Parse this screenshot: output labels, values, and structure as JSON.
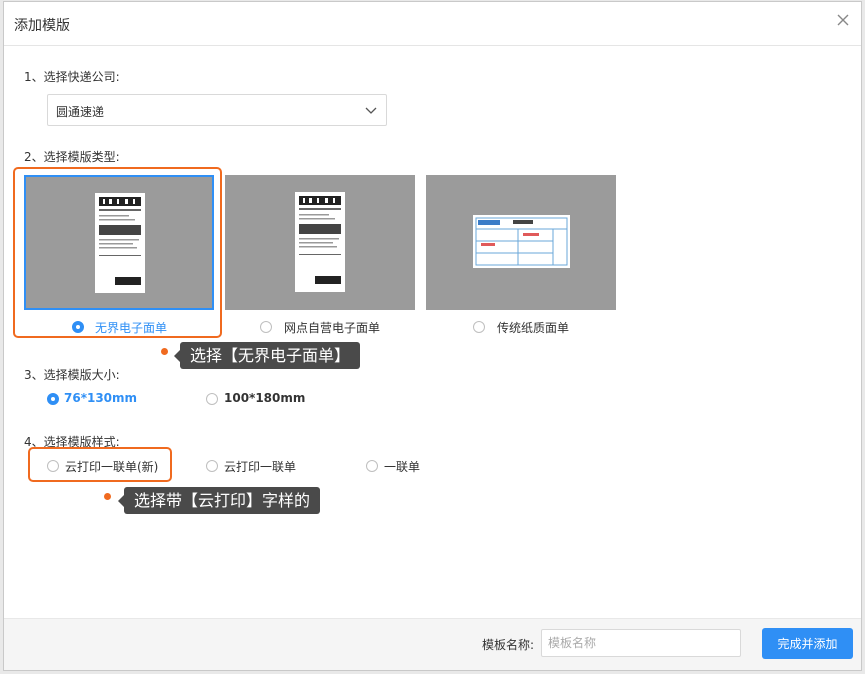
{
  "dialog": {
    "title": "添加模版"
  },
  "sections": {
    "company": {
      "label": "1、选择快递公司:",
      "selected": "圆通速递"
    },
    "type": {
      "label": "2、选择模版类型:",
      "options": [
        {
          "label": "无界电子面单",
          "checked": true
        },
        {
          "label": "网点自营电子面单",
          "checked": false
        },
        {
          "label": "传统纸质面单",
          "checked": false
        }
      ]
    },
    "size": {
      "label": "3、选择模版大小:",
      "options": [
        {
          "label": "76*130mm",
          "checked": true
        },
        {
          "label": "100*180mm",
          "checked": false
        }
      ]
    },
    "style": {
      "label": "4、选择模版样式:",
      "options": [
        {
          "label": "云打印一联单(新)",
          "checked": false
        },
        {
          "label": "云打印一联单",
          "checked": false
        },
        {
          "label": "一联单",
          "checked": false
        }
      ]
    }
  },
  "tips": {
    "tip1": "选择【无界电子面单】",
    "tip2": "选择带【云打印】字样的"
  },
  "footer": {
    "name_label": "模板名称:",
    "name_placeholder": "模板名称",
    "submit": "完成并添加"
  },
  "colors": {
    "accent": "#2f8ff5",
    "highlight": "#f06a1f",
    "tip_bg": "#4a4a4a",
    "card_bg": "#9b9b9b"
  }
}
